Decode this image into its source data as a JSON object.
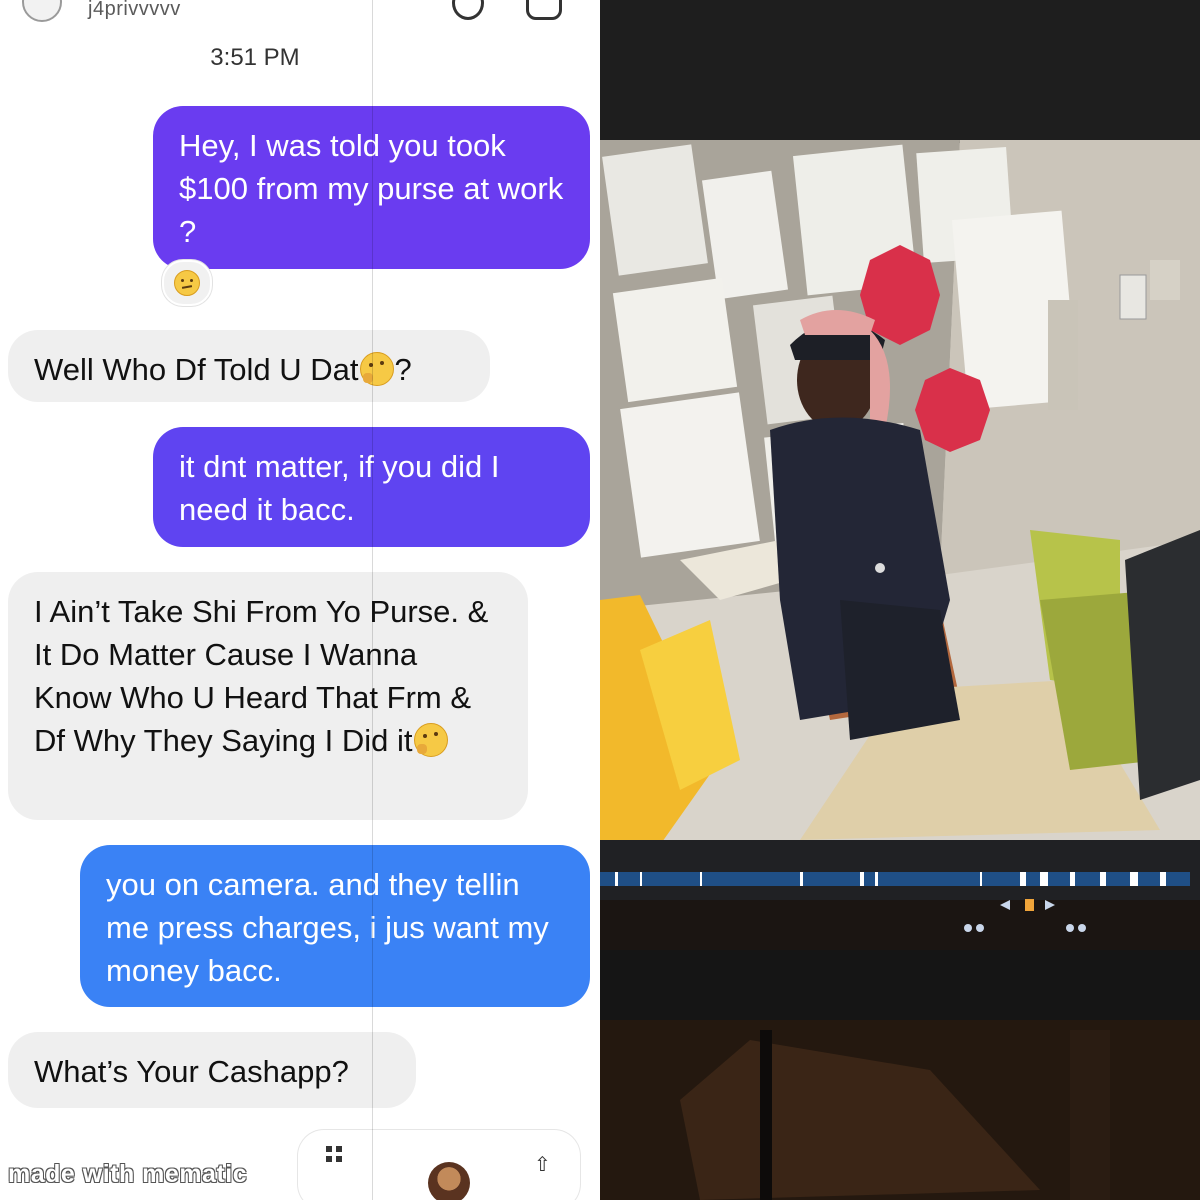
{
  "header": {
    "username": "j4privvvvv",
    "avatar_icon": "avatar-icon",
    "call_icon": "call-icon",
    "video_icon": "video-icon"
  },
  "timestamp": "3:51 PM",
  "messages": [
    {
      "from": "me",
      "text": "Hey, I was told you took $100 from my purse at work ?"
    },
    {
      "from": "them",
      "text": "Well Who Df Told U Dat",
      "suffix": "?",
      "emoji": "thinking-face"
    },
    {
      "from": "me",
      "text": "it dnt matter, if you did I need it bacc."
    },
    {
      "from": "them",
      "text": "I Ain’t Take Shi From Yo Purse. & It Do Matter Cause I Wanna Know Who U Heard That Frm & Df Why They Saying I Did it",
      "emoji": "thinking-face"
    },
    {
      "from": "me",
      "text": "you on camera. and they tellin me press charges, i jus want my money bacc."
    },
    {
      "from": "them",
      "text": "What’s Your Cashapp?"
    }
  ],
  "reaction": "raised-eyebrow-emoji",
  "composer": {
    "qr_icon": "qr-icon",
    "share_icon": "share-icon"
  },
  "watermark": "made with mematic",
  "colors": {
    "sent_purple": "#6a3cf0",
    "sent_violet": "#5f44f1",
    "sent_blue": "#3a82f5",
    "received_gray": "#efefef"
  }
}
